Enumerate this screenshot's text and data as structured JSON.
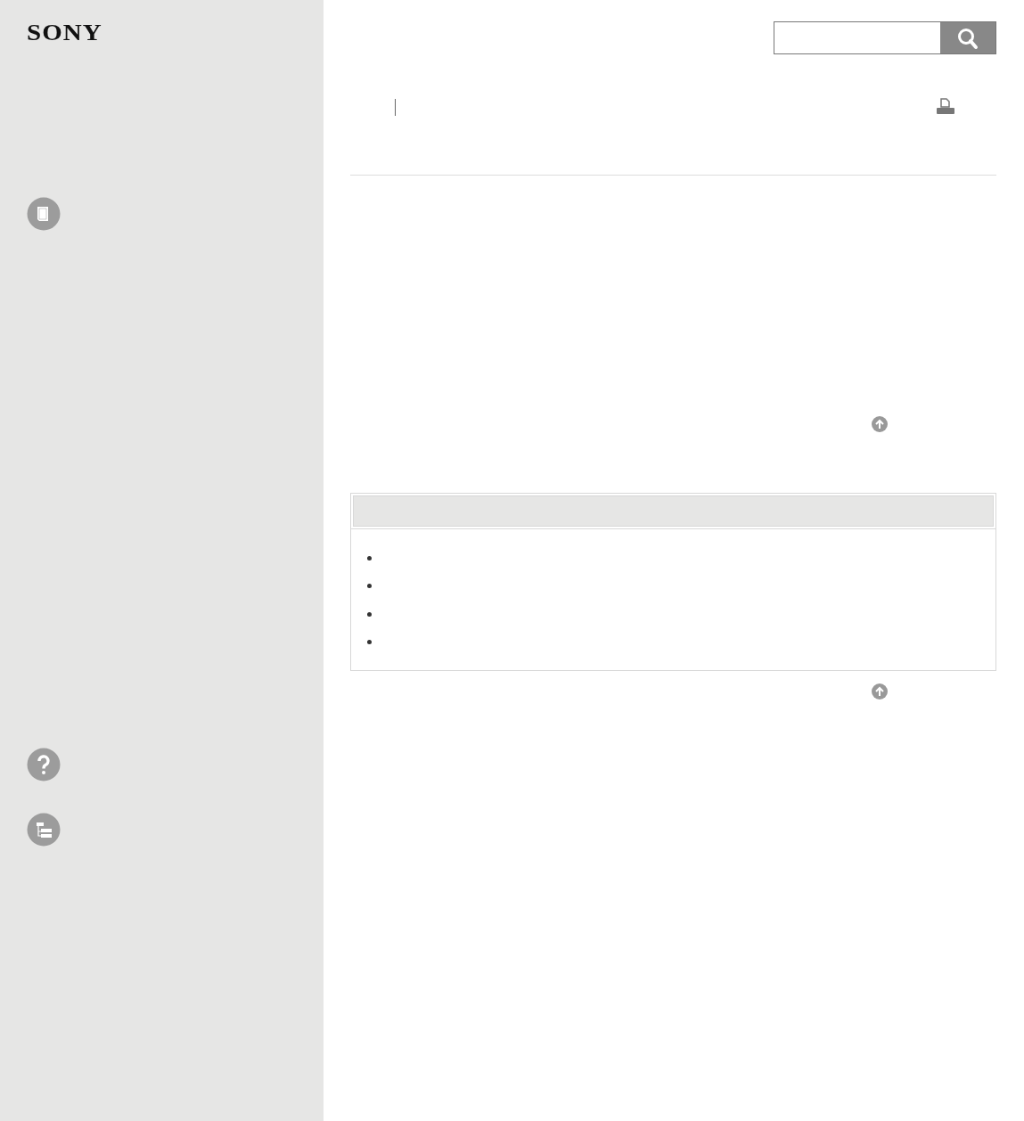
{
  "logo": "SONY",
  "sidebar": {
    "items": [
      {
        "kind": "book"
      },
      {
        "kind": "help"
      },
      {
        "kind": "sitemap"
      }
    ]
  },
  "note": {
    "items": [
      {
        "kind": "bullet"
      },
      {
        "kind": "bullet"
      },
      {
        "kind": "bullet"
      },
      {
        "kind": "bullet"
      }
    ]
  }
}
